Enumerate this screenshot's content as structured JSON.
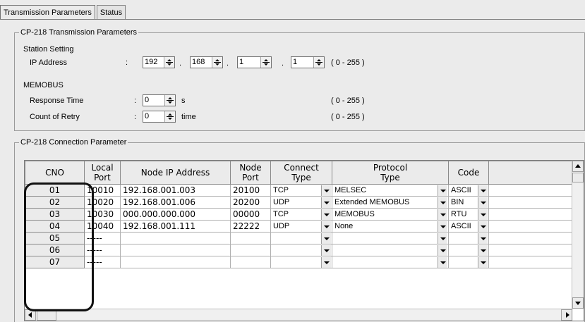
{
  "tabs": [
    {
      "label": "Transmission Parameters",
      "active": true
    },
    {
      "label": "Status",
      "active": false
    }
  ],
  "transmission_group": {
    "legend": "CP-218 Transmission Parameters",
    "station_setting": "Station Setting",
    "ip_label": "IP Address",
    "colon": ":",
    "ip_octets": [
      "192",
      "168",
      "1",
      "1"
    ],
    "ip_dot": ".",
    "ip_range": "( 0 - 255 )",
    "memobus": "MEMOBUS",
    "response_time_label": "Response Time",
    "response_time_value": "0",
    "response_time_unit": "s",
    "response_time_range": "( 0 - 255 )",
    "retry_label": "Count of Retry",
    "retry_value": "0",
    "retry_unit": "time",
    "retry_range": "( 0 - 255 )"
  },
  "connection_group": {
    "legend": "CP-218 Connection Parameter",
    "headers": {
      "cno": "CNO",
      "local_port": "Local\nPort",
      "node_ip": "Node IP Address",
      "node_port": "Node\nPort",
      "connect_type": "Connect\nType",
      "protocol_type": "Protocol\nType",
      "code": "Code"
    },
    "rows": [
      {
        "cno": "01",
        "local_port": "10010",
        "node_ip": "192.168.001.003",
        "node_port": "20100",
        "connect_type": "TCP",
        "protocol": "MELSEC",
        "code": "ASCII"
      },
      {
        "cno": "02",
        "local_port": "10020",
        "node_ip": "192.168.001.006",
        "node_port": "20200",
        "connect_type": "UDP",
        "protocol": "Extended MEMOBUS",
        "code": "BIN"
      },
      {
        "cno": "03",
        "local_port": "10030",
        "node_ip": "000.000.000.000",
        "node_port": "00000",
        "connect_type": "TCP",
        "protocol": "MEMOBUS",
        "code": "RTU"
      },
      {
        "cno": "04",
        "local_port": "10040",
        "node_ip": "192.168.001.111",
        "node_port": "22222",
        "connect_type": "UDP",
        "protocol": "None",
        "code": "ASCII"
      },
      {
        "cno": "05",
        "local_port": "-----",
        "node_ip": "",
        "node_port": "",
        "connect_type": "",
        "protocol": "",
        "code": ""
      },
      {
        "cno": "06",
        "local_port": "-----",
        "node_ip": "",
        "node_port": "",
        "connect_type": "",
        "protocol": "",
        "code": ""
      },
      {
        "cno": "07",
        "local_port": "-----",
        "node_ip": "",
        "node_port": "",
        "connect_type": "",
        "protocol": "",
        "code": ""
      }
    ]
  },
  "colors": {
    "window_bg": "#ebebeb",
    "grid_bg": "#ffffff",
    "highlight": "#111111"
  }
}
